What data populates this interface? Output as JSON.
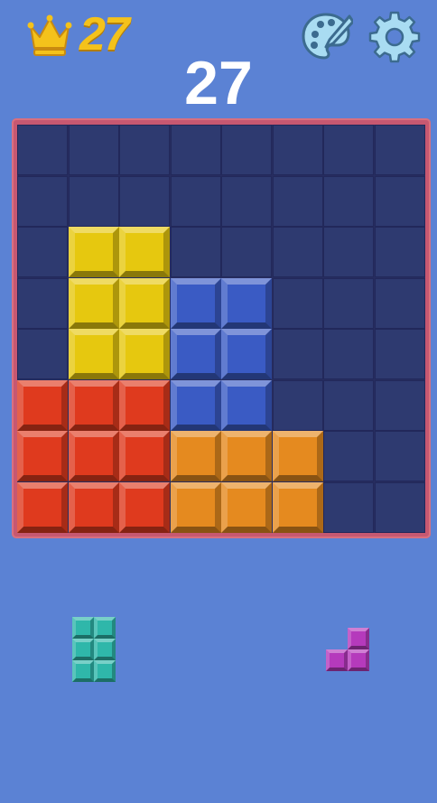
{
  "header": {
    "best_score": "27",
    "best_icon": "crown-icon",
    "theme_icon": "palette-icon",
    "settings_icon": "gear-icon"
  },
  "score": "27",
  "colors": {
    "background": "#5b82d4",
    "board_frame": "#c75871",
    "empty_cell": "#2e3a70",
    "yellow": "#e6c80f",
    "blue": "#3a5bc4",
    "red": "#df3a1e",
    "orange": "#e58a1f",
    "teal": "#2fb7aa",
    "magenta": "#b53abc"
  },
  "board": {
    "rows": 8,
    "cols": 8,
    "grid": [
      [
        null,
        null,
        null,
        null,
        null,
        null,
        null,
        null
      ],
      [
        null,
        null,
        null,
        null,
        null,
        null,
        null,
        null
      ],
      [
        null,
        "yellow",
        "yellow",
        null,
        null,
        null,
        null,
        null
      ],
      [
        null,
        "yellow",
        "yellow",
        "blue",
        "blue",
        null,
        null,
        null
      ],
      [
        null,
        "yellow",
        "yellow",
        "blue",
        "blue",
        null,
        null,
        null
      ],
      [
        "red",
        "red",
        "red",
        "blue",
        "blue",
        null,
        null,
        null
      ],
      [
        "red",
        "red",
        "red",
        "orange",
        "orange",
        "orange",
        null,
        null
      ],
      [
        "red",
        "red",
        "red",
        "orange",
        "orange",
        "orange",
        null,
        null
      ]
    ]
  },
  "tray": [
    {
      "name": "tray-piece-teal-2x3",
      "color": "teal",
      "cells": [
        [
          0,
          0
        ],
        [
          0,
          1
        ],
        [
          1,
          0
        ],
        [
          1,
          1
        ],
        [
          2,
          0
        ],
        [
          2,
          1
        ]
      ]
    },
    {
      "name": "tray-piece-magenta-l",
      "color": "magenta",
      "cells": [
        [
          0,
          1
        ],
        [
          1,
          0
        ],
        [
          1,
          1
        ]
      ]
    }
  ]
}
